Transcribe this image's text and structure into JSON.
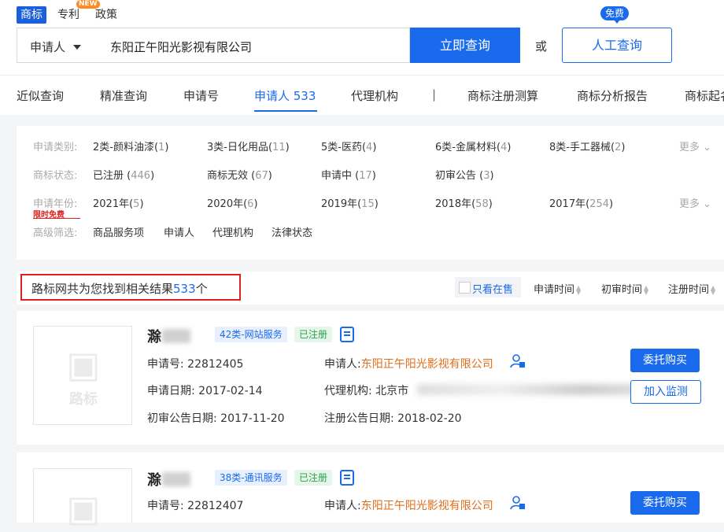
{
  "top_tabs": [
    "商标",
    "专利",
    "政策"
  ],
  "new_badge": "NEW",
  "search": {
    "type_label": "申请人",
    "value": "东阳正午阳光影视有限公司",
    "query_button": "立即查询",
    "or_text": "或",
    "manual_button": "人工查询",
    "free_badge": "免费"
  },
  "nav": {
    "items": [
      "近似查询",
      "精准查询",
      "申请号",
      "申请人 533",
      "代理机构",
      "|",
      "商标注册测算",
      "商标分析报告",
      "商标起名"
    ],
    "active_index": 3
  },
  "filters": {
    "category_label": "申请类别:",
    "categories": [
      {
        "name": "2类-颜料油漆",
        "count": "1"
      },
      {
        "name": "3类-日化用品",
        "count": "11"
      },
      {
        "name": "5类-医药",
        "count": "4"
      },
      {
        "name": "6类-金属材料",
        "count": "4"
      },
      {
        "name": "8类-手工器械",
        "count": "2"
      }
    ],
    "more_label": "更多",
    "status_label": "商标状态:",
    "statuses": [
      {
        "name": "已注册",
        "count": "446"
      },
      {
        "name": "商标无效",
        "count": "67"
      },
      {
        "name": "申请中",
        "count": "17"
      },
      {
        "name": "初审公告",
        "count": "3"
      }
    ],
    "year_label": "申请年份:",
    "years": [
      {
        "name": "2021年",
        "count": "5"
      },
      {
        "name": "2020年",
        "count": "6"
      },
      {
        "name": "2019年",
        "count": "15"
      },
      {
        "name": "2018年",
        "count": "58"
      },
      {
        "name": "2017年",
        "count": "254"
      }
    ],
    "promo": "限时免费",
    "advanced_label": "高级筛选:",
    "advanced": [
      "商品服务项",
      "申请人",
      "代理机构",
      "法律状态"
    ]
  },
  "results": {
    "prefix": "路标网共为您找到相关结果",
    "count": "533",
    "suffix": "个",
    "only_on_sale": "只看在售",
    "sort_options": [
      "申请时间",
      "初审时间",
      "注册时间"
    ]
  },
  "cards": [
    {
      "name_prefix": "滁",
      "class_tag": "42类-网站服务",
      "status": "已注册",
      "app_no_label": "申请号:",
      "app_no": "22812405",
      "applicant_label": "申请人:",
      "applicant": "东阳正午阳光影视有限公司",
      "app_date_label": "申请日期:",
      "app_date": "2017-02-14",
      "agent_label": "代理机构:",
      "agent": "北京市",
      "prelim_label": "初审公告日期:",
      "prelim_date": "2017-11-20",
      "reg_label": "注册公告日期:",
      "reg_date": "2018-02-20",
      "buy_button": "委托购买",
      "watch_button": "加入监测",
      "logo_text": "路标"
    },
    {
      "name_prefix": "滁",
      "class_tag": "38类-通讯服务",
      "status": "已注册",
      "app_no_label": "申请号:",
      "app_no": "22812407",
      "applicant_label": "申请人:",
      "applicant": "东阳正午阳光影视有限公司",
      "buy_button": "委托购买"
    }
  ]
}
